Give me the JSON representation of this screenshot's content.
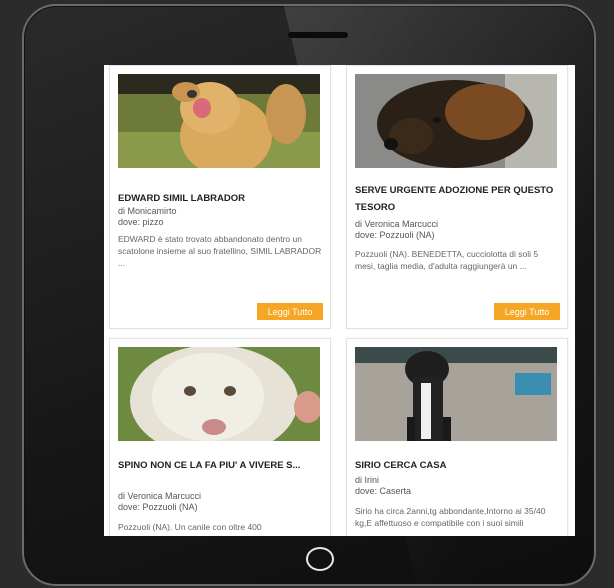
{
  "cards": [
    {
      "title": "EDWARD SIMIL LABRADOR",
      "author": "di Monicamirto",
      "location": "dove: pizzo",
      "excerpt": "EDWARD è stato trovato abbandonato dentro un scatolone insieme al suo fratellino, SIMIL LABRADOR ...",
      "button": "Leggi Tutto"
    },
    {
      "title": "SERVE URGENTE ADOZIONE PER QUESTO TESORO",
      "author": "di Veronica Marcucci",
      "location": "dove: Pozzuoli (NA)",
      "excerpt": "Pozzuoli (NA). BENEDETTA, cucciolotta di soli 5 mesi, taglia media, d'adulta raggiungerà un ...",
      "button": "Leggi Tutto"
    },
    {
      "title": "SPINO NON CE LA FA PIU' A VIVERE S...",
      "author": "di Veronica Marcucci",
      "location": "dove: Pozzuoli (NA)",
      "excerpt": "Pozzuoli (NA). Un canile con oltre 400"
    },
    {
      "title": "SIRIO CERCA CASA",
      "author": "di Irini",
      "location": "dove: Caserta",
      "excerpt": "Sirio ha circa 2anni,tg abbondante,Intorno ai 35/40 kg,E affettuoso e compatibile con i suoi simili"
    }
  ],
  "colors": {
    "accent": "#f5a623",
    "device": "#1a1a1a"
  }
}
